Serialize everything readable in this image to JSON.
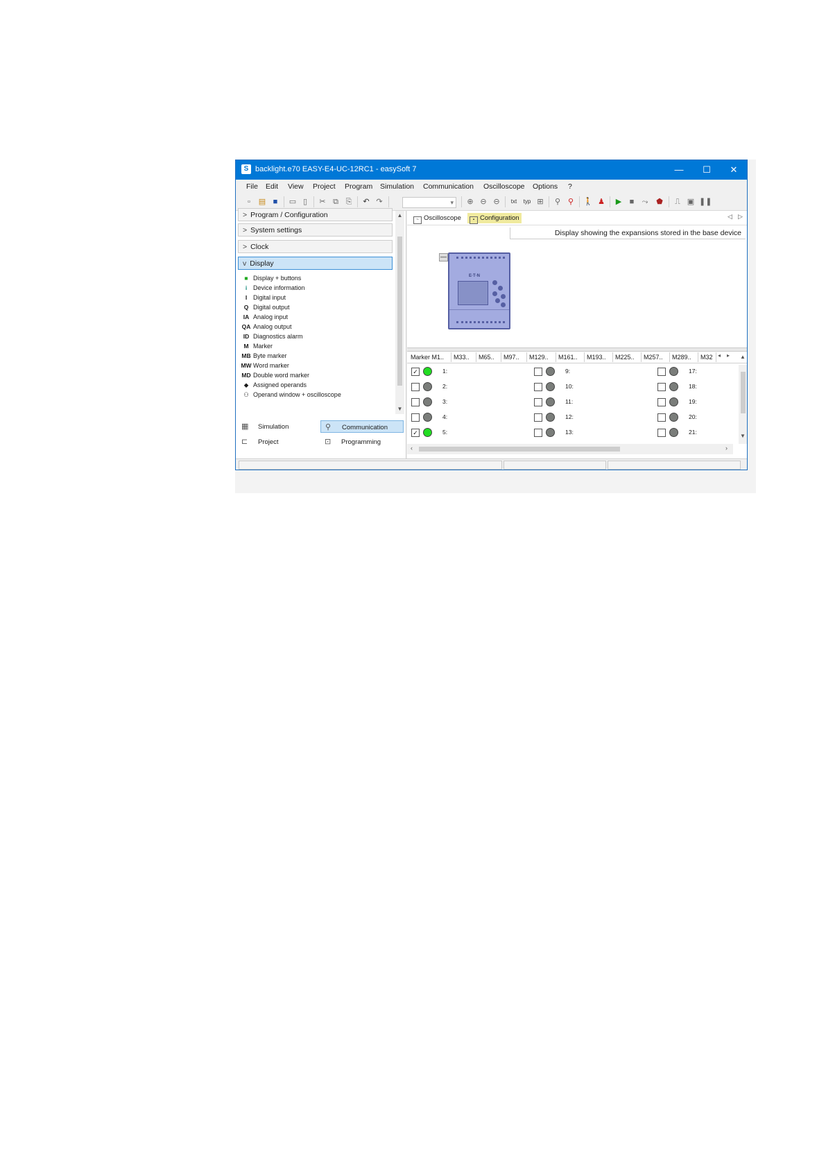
{
  "window": {
    "title": "backlight.e70 EASY-E4-UC-12RC1 - easySoft 7",
    "app_icon": "S",
    "controls": [
      "—",
      "☐",
      "✕"
    ]
  },
  "menu": [
    "File",
    "Edit",
    "View",
    "Project",
    "Program",
    "Simulation",
    "Communication",
    "Oscilloscope",
    "Options",
    "?"
  ],
  "sidebar": {
    "groups": [
      {
        "label": "Program / Configuration"
      },
      {
        "label": "System settings"
      },
      {
        "label": "Clock"
      },
      {
        "label": "Display"
      }
    ],
    "items": [
      {
        "icon": "■",
        "label": "Display + buttons"
      },
      {
        "icon": "i",
        "label": "Device information"
      },
      {
        "icon": "I",
        "label": "Digital input"
      },
      {
        "icon": "Q",
        "label": "Digital output"
      },
      {
        "icon": "IA",
        "label": "Analog input"
      },
      {
        "icon": "QA",
        "label": "Analog output"
      },
      {
        "icon": "ID",
        "label": "Diagnostics alarm"
      },
      {
        "icon": "M",
        "label": "Marker"
      },
      {
        "icon": "MB",
        "label": "Byte marker"
      },
      {
        "icon": "MW",
        "label": "Word marker"
      },
      {
        "icon": "MD",
        "label": "Double word marker"
      },
      {
        "icon": "◆",
        "label": "Assigned operands"
      },
      {
        "icon": "⚇",
        "label": "Operand window + oscilloscope"
      }
    ],
    "nav": {
      "simulation": "Simulation",
      "communication": "Communication",
      "project": "Project",
      "programming": "Programming"
    }
  },
  "tabs": {
    "oscilloscope": "Oscilloscope",
    "configuration": "Configuration",
    "prev": "◁",
    "next": "▷"
  },
  "device_label": "Display showing the expansions stored in the base device",
  "device": {
    "brand": "E·T·N",
    "collapse": "—"
  },
  "marker_tabs": [
    "Marker M1..",
    "M33..",
    "M65..",
    "M97..",
    "M129..",
    "M161..",
    "M193..",
    "M225..",
    "M257..",
    "M289..",
    "M32"
  ],
  "markers": [
    {
      "label": "1:",
      "checked": true,
      "on": true
    },
    {
      "label": "2:",
      "checked": false,
      "on": false
    },
    {
      "label": "3:",
      "checked": false,
      "on": false
    },
    {
      "label": "4:",
      "checked": false,
      "on": false
    },
    {
      "label": "5:",
      "checked": true,
      "on": true
    },
    {
      "label": "9:",
      "checked": false,
      "on": false
    },
    {
      "label": "10:",
      "checked": false,
      "on": false
    },
    {
      "label": "11:",
      "checked": false,
      "on": false
    },
    {
      "label": "12:",
      "checked": false,
      "on": false
    },
    {
      "label": "13:",
      "checked": false,
      "on": false
    },
    {
      "label": "17:",
      "checked": false,
      "on": false
    },
    {
      "label": "18:",
      "checked": false,
      "on": false
    },
    {
      "label": "19:",
      "checked": false,
      "on": false
    },
    {
      "label": "20:",
      "checked": false,
      "on": false
    },
    {
      "label": "21:",
      "checked": false,
      "on": false
    }
  ],
  "colors": {
    "titlebar": "#0078d7",
    "led_on": "#22dd22",
    "led_off": "#7a7d7a",
    "config_tab": "#f0ea9e",
    "selection": "#cce4f7"
  }
}
